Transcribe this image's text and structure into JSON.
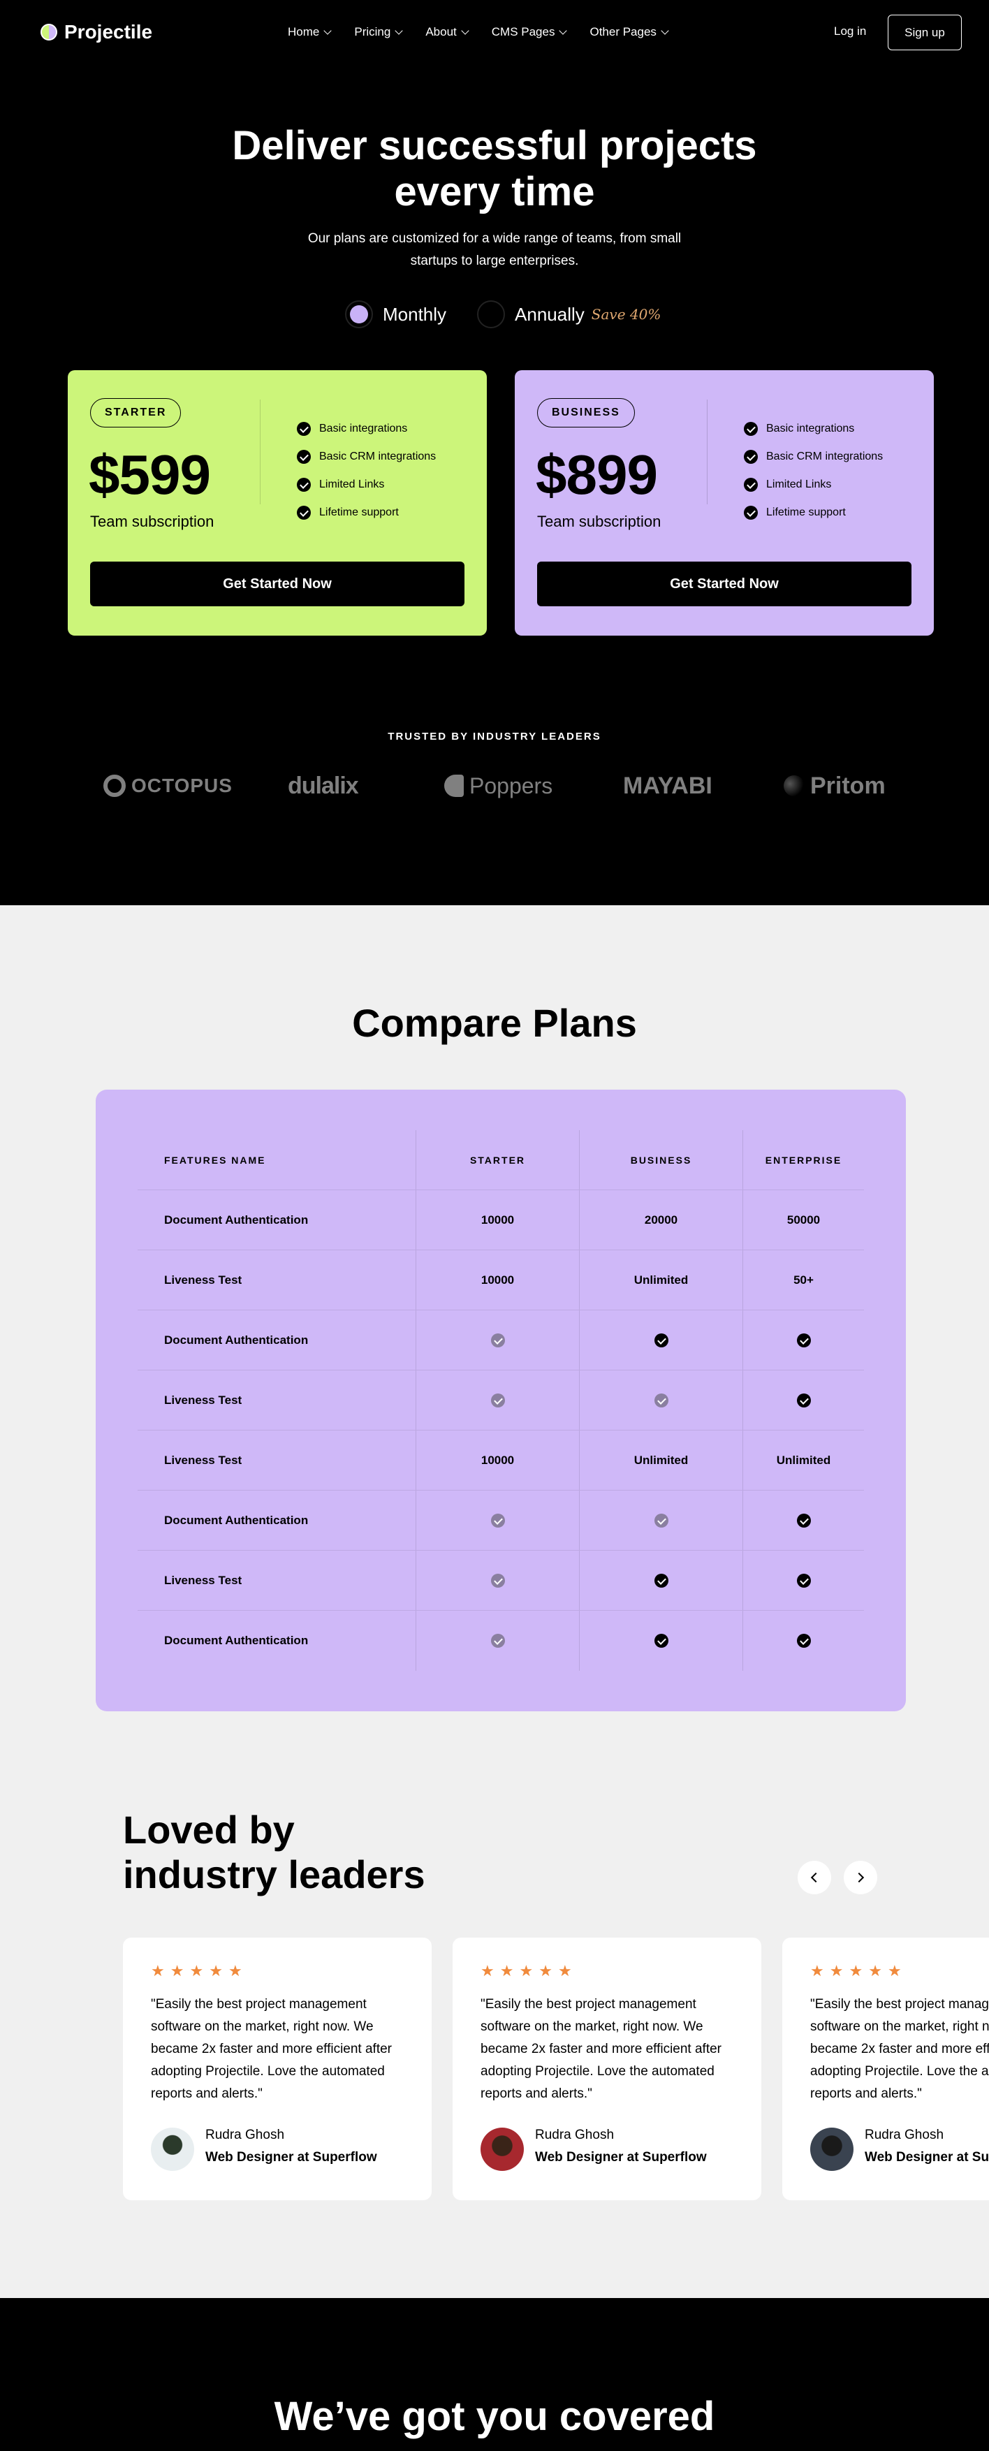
{
  "nav": {
    "brand": "Projectile",
    "items": [
      {
        "label": "Home"
      },
      {
        "label": "Pricing"
      },
      {
        "label": "About"
      },
      {
        "label": "CMS Pages"
      },
      {
        "label": "Other Pages"
      }
    ],
    "login": "Log in",
    "signup": "Sign up"
  },
  "hero": {
    "title_line1": "Deliver successful projects",
    "title_line2": "every time",
    "subtitle": "Our plans are customized for a wide range of teams, from small startups to large enterprises.",
    "toggle": {
      "monthly": "Monthly",
      "annually": "Annually",
      "save": "Save 40%",
      "selected": "Monthly"
    }
  },
  "plans": [
    {
      "badge": "STARTER",
      "price": "$599",
      "subtitle": "Team subscription",
      "features": [
        "Basic integrations",
        "Basic CRM integrations",
        "Limited Links",
        "Lifetime support"
      ],
      "cta": "Get Started Now",
      "color": "#ccf57a"
    },
    {
      "badge": "BUSINESS",
      "price": "$899",
      "subtitle": "Team subscription",
      "features": [
        "Basic integrations",
        "Basic CRM integrations",
        "Limited Links",
        "Lifetime support"
      ],
      "cta": "Get Started Now",
      "color": "#cfb8f8"
    }
  ],
  "trusted": {
    "heading": "TRUSTED BY INDUSTRY LEADERS",
    "brands": [
      "OCTOPUS",
      "dulalix",
      "Poppers",
      "MAYABI",
      "Pritom"
    ]
  },
  "compare": {
    "title": "Compare Plans",
    "headers": [
      "FEATURES NAME",
      "STARTER",
      "BUSINESS",
      "ENTERPRISE"
    ],
    "rows": [
      {
        "name": "Document Authentication",
        "values": [
          "10000",
          "20000",
          "50000"
        ]
      },
      {
        "name": "Liveness Test",
        "values": [
          "10000",
          "Unlimited",
          "50+"
        ]
      },
      {
        "name": "Document Authentication",
        "values": [
          "part",
          "yes",
          "yes"
        ]
      },
      {
        "name": "Liveness Test",
        "values": [
          "part",
          "part",
          "yes"
        ]
      },
      {
        "name": "Liveness Test",
        "values": [
          "10000",
          "Unlimited",
          "Unlimited"
        ]
      },
      {
        "name": "Document Authentication",
        "values": [
          "part",
          "part",
          "yes"
        ]
      },
      {
        "name": "Liveness Test",
        "values": [
          "part",
          "yes",
          "yes"
        ]
      },
      {
        "name": "Document Authentication",
        "values": [
          "part",
          "yes",
          "yes"
        ]
      }
    ]
  },
  "testimonials": {
    "title_line1": "Loved by",
    "title_line2": "industry leaders",
    "items": [
      {
        "rating": 5,
        "quote": "\"Easily the best project management software on the market, right now. We became 2x faster and more efficient after adopting Projectile. Love the automated reports and alerts.\"",
        "name": "Rudra Ghosh",
        "role": "Web Designer at Superflow"
      },
      {
        "rating": 5,
        "quote": "\"Easily the best project management software on the market, right now. We became 2x faster and more efficient after adopting Projectile. Love the automated reports and alerts.\"",
        "name": "Rudra Ghosh",
        "role": "Web Designer at Superflow"
      },
      {
        "rating": 5,
        "quote": "\"Easily the best project management software on the market, right now. We became 2x faster and more efficient after adopting Projectile. Love the automated reports and alerts.\"",
        "name": "Rudra Ghosh",
        "role": "Web Designer at Superflow"
      }
    ]
  },
  "footer_band": {
    "heading": "We’ve got you covered"
  }
}
